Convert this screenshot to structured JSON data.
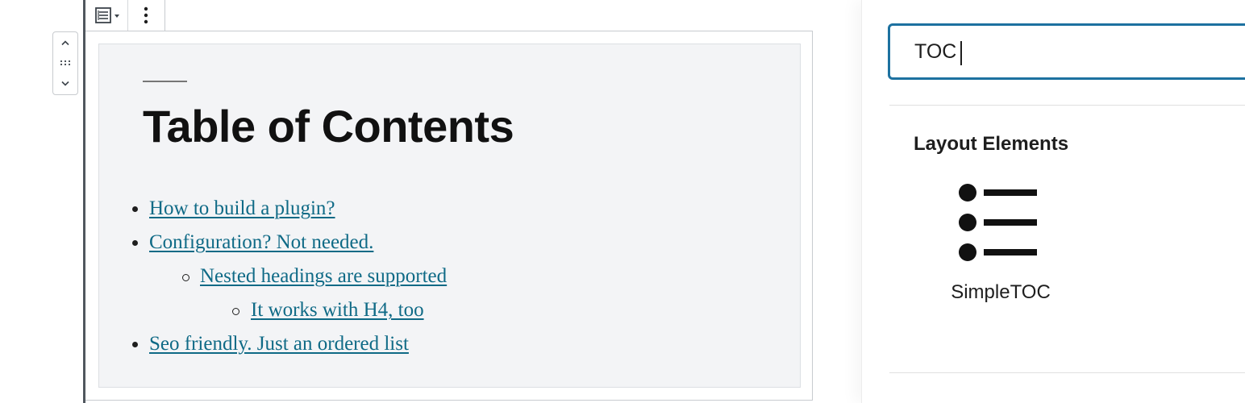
{
  "editor": {
    "block_title": "Table of Contents",
    "toc_items": [
      {
        "label": "How to build a plugin?",
        "level": 1
      },
      {
        "label": "Configuration? Not needed.",
        "level": 1
      },
      {
        "label": "Nested headings are supported",
        "level": 2
      },
      {
        "label": "It works with H4, too",
        "level": 3
      },
      {
        "label": "Seo friendly. Just an ordered list",
        "level": 1
      }
    ],
    "toolbar": {
      "block_type_icon": "table-of-contents-icon",
      "more_options_icon": "vertical-ellipsis-icon"
    },
    "mover": {
      "up_icon": "chevron-up-icon",
      "drag_icon": "drag-handle-icon",
      "down_icon": "chevron-down-icon"
    }
  },
  "inserter": {
    "search_value": "TOC",
    "category_title": "Layout Elements",
    "results": [
      {
        "label": "SimpleTOC",
        "icon": "list-bullet-icon"
      }
    ]
  },
  "colors": {
    "link": "#0f6a86",
    "focus_border": "#1d71a0",
    "block_background": "#f3f4f6",
    "editor_edge": "#50575e"
  }
}
